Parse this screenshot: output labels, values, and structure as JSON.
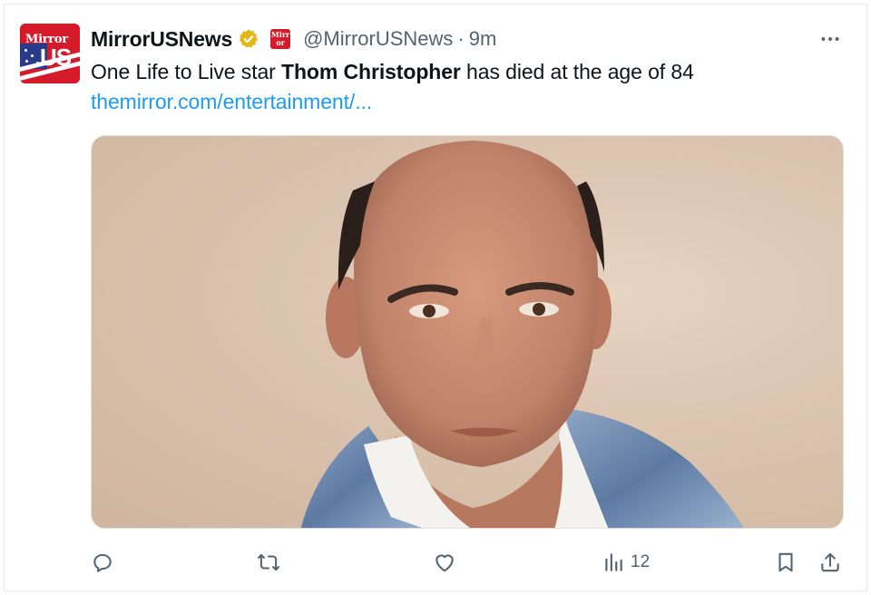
{
  "tweet": {
    "author": {
      "display_name": "MirrorUSNews",
      "handle": "@MirrorUSNews",
      "avatar_text": "Mirror US",
      "affiliate_badge_text": "Mirr or",
      "verified": true
    },
    "separator": "·",
    "time_ago": "9m",
    "text_before": "One Life to Live star ",
    "text_bold": "Thom Christopher",
    "text_after": " has died at the age of 84",
    "link_text": "themirror.com/entertainment/...",
    "media_icon": "photo-portrait",
    "more_label": "•••"
  },
  "actions": {
    "reply_icon": "reply-icon",
    "retweet_icon": "retweet-icon",
    "like_icon": "heart-icon",
    "views_icon": "views-chart-icon",
    "views_count": "12",
    "bookmark_icon": "bookmark-icon",
    "share_icon": "share-icon"
  },
  "colors": {
    "link": "#1d9bf0",
    "muted": "#536471",
    "verified_gold": "#e2b719",
    "brand_red": "#d51a2a"
  }
}
